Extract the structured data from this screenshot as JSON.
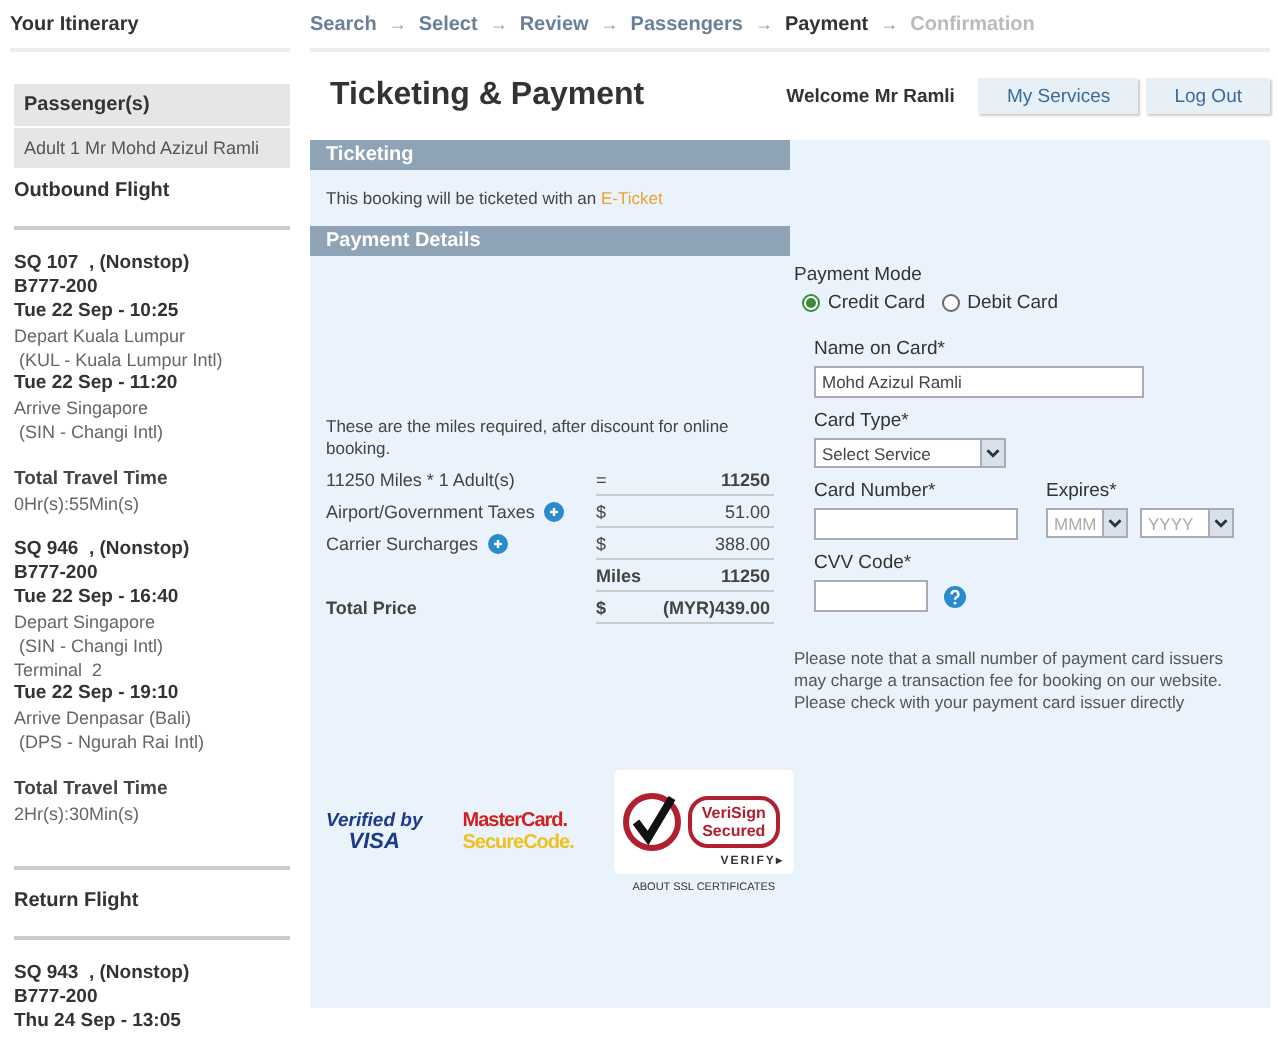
{
  "sidebar": {
    "title": "Your Itinerary",
    "passengers_header": "Passenger(s)",
    "passengers": [
      "Adult 1 Mr Mohd Azizul Ramli"
    ],
    "sections": [
      {
        "title": "Outbound Flight",
        "flights": [
          {
            "lines": [
              {
                "kind": "bold",
                "text": "SQ 107  , (Nonstop)"
              },
              {
                "kind": "bold",
                "text": "B777-200"
              },
              {
                "kind": "bold",
                "text": "Tue 22 Sep - 10:25"
              },
              {
                "kind": "plain",
                "text": "Depart Kuala Lumpur"
              },
              {
                "kind": "plain",
                "text": " (KUL - Kuala Lumpur Intl)"
              },
              {
                "kind": "bold",
                "text": "Tue 22 Sep - 11:20"
              },
              {
                "kind": "plain",
                "text": "Arrive Singapore"
              },
              {
                "kind": "plain",
                "text": " (SIN - Changi Intl)"
              }
            ],
            "travel_label": "Total Travel Time",
            "travel_time": "0Hr(s):55Min(s)"
          },
          {
            "lines": [
              {
                "kind": "bold",
                "text": "SQ 946  , (Nonstop)"
              },
              {
                "kind": "bold",
                "text": "B777-200"
              },
              {
                "kind": "bold",
                "text": "Tue 22 Sep - 16:40"
              },
              {
                "kind": "plain",
                "text": "Depart Singapore"
              },
              {
                "kind": "plain",
                "text": " (SIN - Changi Intl)"
              },
              {
                "kind": "plain",
                "text": "Terminal  2"
              },
              {
                "kind": "bold",
                "text": "Tue 22 Sep - 19:10"
              },
              {
                "kind": "plain",
                "text": "Arrive Denpasar (Bali)"
              },
              {
                "kind": "plain",
                "text": " (DPS - Ngurah Rai Intl)"
              }
            ],
            "travel_label": "Total Travel Time",
            "travel_time": "2Hr(s):30Min(s)"
          }
        ]
      },
      {
        "title": "Return Flight",
        "flights": [
          {
            "lines": [
              {
                "kind": "bold",
                "text": "SQ 943  , (Nonstop)"
              },
              {
                "kind": "bold",
                "text": "B777-200"
              },
              {
                "kind": "bold",
                "text": "Thu 24 Sep - 13:05"
              }
            ]
          }
        ]
      }
    ]
  },
  "breadcrumb": [
    {
      "label": "Search",
      "selected": false,
      "disabled": false,
      "separator": "→"
    },
    {
      "label": "Select",
      "selected": false,
      "disabled": false,
      "separator": "→"
    },
    {
      "label": "Review",
      "selected": false,
      "disabled": false,
      "separator": "→"
    },
    {
      "label": "Passengers",
      "selected": false,
      "disabled": false,
      "separator": "→"
    },
    {
      "label": "Payment",
      "selected": true,
      "disabled": false,
      "separator": "→"
    },
    {
      "label": "Confirmation",
      "selected": false,
      "disabled": true
    }
  ],
  "header": {
    "title": "Ticketing & Payment",
    "welcome": "Welcome Mr  Ramli",
    "buttons": [
      "My Services",
      "Log Out"
    ]
  },
  "ticketing": {
    "heading": "Ticketing",
    "text": "This booking will be ticketed with an ",
    "link": "E-Ticket"
  },
  "payment": {
    "heading": "Payment Details",
    "miles_note": "These are the miles required, after discount for online booking.",
    "rows": [
      {
        "label": "11250 Miles   * 1 Adult(s)",
        "info": false,
        "symbol": "=",
        "value": "11250",
        "bold": false,
        "value_bold": true
      },
      {
        "label": "Airport/Government Taxes",
        "info": true,
        "symbol": "$",
        "value": "51.00",
        "bold": false
      },
      {
        "label": "Carrier Surcharges",
        "info": true,
        "symbol": "$",
        "value": "388.00",
        "bold": false
      },
      {
        "label": "",
        "info": false,
        "symbol": "Miles",
        "value": "11250",
        "bold": true
      },
      {
        "label": "Total Price",
        "info": false,
        "symbol": "$",
        "value": "(MYR)439.00",
        "bold": true
      }
    ],
    "mode_label": "Payment Mode",
    "modes": [
      {
        "label": "Credit Card",
        "selected": true
      },
      {
        "label": "Debit Card",
        "selected": false
      }
    ],
    "name_label": "Name on Card*",
    "name_value": "Mohd Azizul Ramli",
    "card_type_label": "Card Type*",
    "card_type_value": "Select Service",
    "card_number_label": "Card Number*",
    "expires_label": "Expires*",
    "month_value": "MMM",
    "year_value": "YYYY",
    "cvv_label": "CVV Code*",
    "note": "Please note that a small number of payment card issuers may charge a transaction fee for booking on our website. Please check with your payment card issuer directly"
  },
  "seals": {
    "visa": [
      "Verified",
      "by",
      "VISA"
    ],
    "mastercard": [
      "MasterCard.",
      "SecureCode."
    ],
    "verisign": [
      "VeriSign",
      "Secured",
      "VERIFY▸"
    ],
    "ssl_link": "ABOUT SSL CERTIFICATES"
  }
}
